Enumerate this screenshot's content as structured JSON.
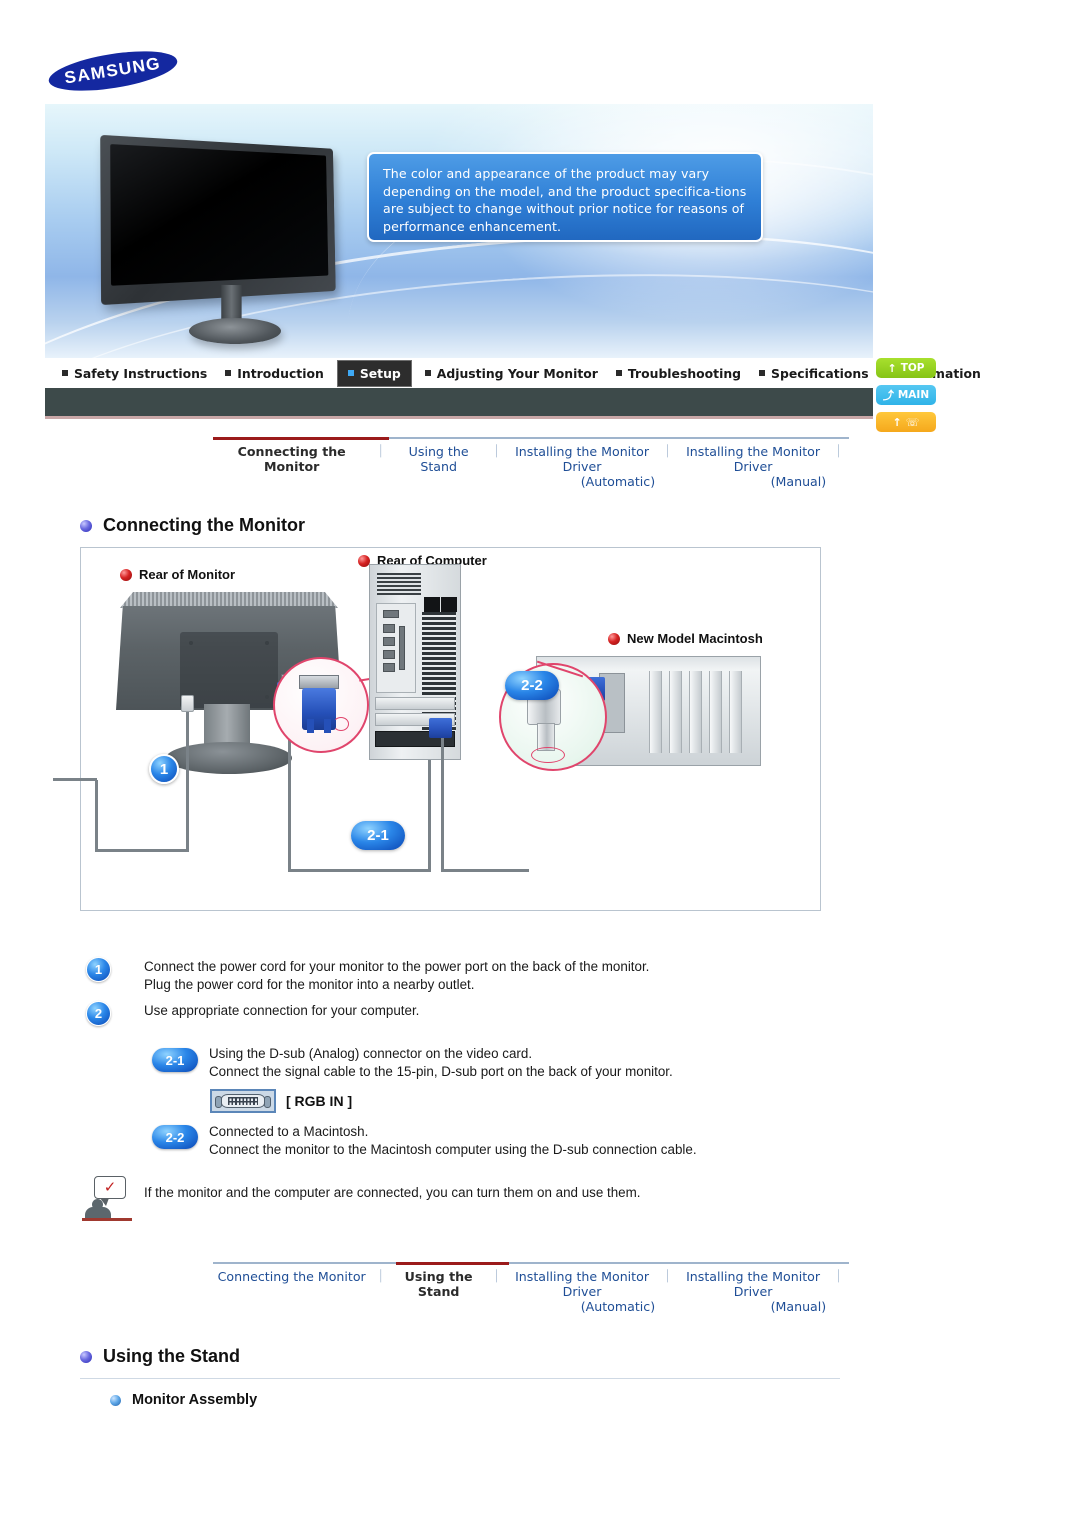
{
  "brand": {
    "name": "SAMSUNG"
  },
  "banner": {
    "notice": "The color and appearance of the product may vary depending on the model, and the product specifica-tions are subject to change without prior notice for reasons of performance enhancement."
  },
  "main_nav": {
    "items": [
      {
        "label": "Safety Instructions",
        "active": false
      },
      {
        "label": "Introduction",
        "active": false
      },
      {
        "label": "Setup",
        "active": true
      },
      {
        "label": "Adjusting Your Monitor",
        "active": false
      },
      {
        "label": "Troubleshooting",
        "active": false
      },
      {
        "label": "Specifications",
        "active": false
      },
      {
        "label": "Information",
        "active": false
      }
    ]
  },
  "side_buttons": [
    {
      "label": "TOP",
      "icon": "up-arrow-icon",
      "color": "#9ad621"
    },
    {
      "label": "MAIN",
      "icon": "turn-arrow-icon",
      "color": "#3dbdec"
    },
    {
      "label": "",
      "icon": "home-arrow-icon",
      "color": "#f9b024"
    }
  ],
  "subnav_top": {
    "tabs": [
      {
        "label": "Connecting the Monitor",
        "sub": "",
        "active": true
      },
      {
        "label": "Using the Stand",
        "sub": "",
        "active": false
      },
      {
        "label": "Installing the Monitor Driver",
        "sub": "(Automatic)",
        "active": false
      },
      {
        "label": "Installing the Monitor Driver",
        "sub": "(Manual)",
        "active": false
      }
    ],
    "separator": "⏐"
  },
  "subnav_bottom": {
    "tabs": [
      {
        "label": "Connecting the Monitor",
        "sub": "",
        "active": false
      },
      {
        "label": "Using the Stand",
        "sub": "",
        "active": true
      },
      {
        "label": "Installing the Monitor Driver",
        "sub": "(Automatic)",
        "active": false
      },
      {
        "label": "Installing the Monitor Driver",
        "sub": "(Manual)",
        "active": false
      }
    ],
    "separator": "⏐"
  },
  "sections": {
    "connecting": {
      "title": "Connecting the Monitor"
    },
    "using_stand": {
      "title": "Using the Stand",
      "sub_title": "Monitor Assembly"
    }
  },
  "diagram": {
    "labels": {
      "rear_of_monitor": "Rear of Monitor",
      "rear_of_computer": "Rear of Computer",
      "new_model_macintosh": "New Model Macintosh"
    },
    "badges": {
      "one": "1",
      "two_one": "2-1",
      "two_two": "2-2"
    }
  },
  "instructions": [
    {
      "badge": "1",
      "type": "round",
      "lines": [
        "Connect the power cord for your monitor to the power port on the back of the monitor.",
        "Plug the power cord for the monitor into a nearby outlet."
      ]
    },
    {
      "badge": "2",
      "type": "round",
      "lines": [
        "Use appropriate connection for your computer."
      ]
    },
    {
      "badge": "2-1",
      "type": "pill",
      "lines": [
        "Using the D-sub (Analog) connector on the video card.",
        "Connect the signal cable to the 15-pin, D-sub port on the back of your monitor."
      ]
    },
    {
      "badge": "2-2",
      "type": "pill",
      "lines": [
        "Connected to a Macintosh.",
        "Connect the monitor to the Macintosh computer using the D-sub connection cable."
      ]
    }
  ],
  "rgb_in": {
    "label": "[ RGB IN ]",
    "icon": "dsub-port-icon"
  },
  "note": {
    "icon": "note-person-check-icon",
    "text": "If the monitor and the computer are connected, you can turn them on and use them."
  },
  "colors": {
    "accent_blue": "#1f4e96",
    "active_tab": "#9b1b1b",
    "badge_blue": "#2a86e8",
    "navbar_dark": "#3d4a4a",
    "brand_blue": "#1428a0"
  }
}
